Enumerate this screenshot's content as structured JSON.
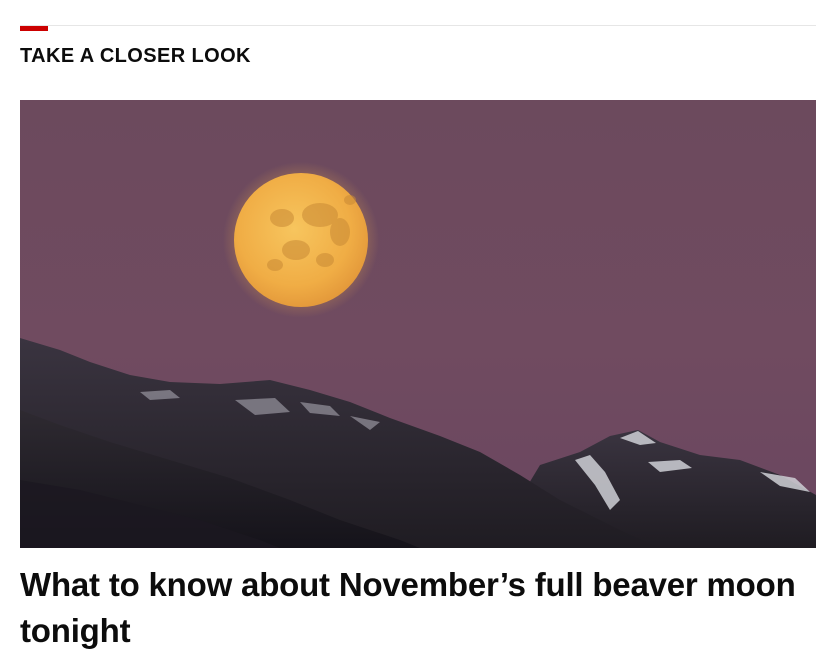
{
  "section": {
    "title": "TAKE A CLOSER LOOK",
    "accent_color": "#cc0000"
  },
  "card": {
    "image_subject": "full moon rising over dark mountains at dusk",
    "headline": "What to know about November’s full beaver moon tonight"
  },
  "colors": {
    "sky": "#6e4a5e",
    "moon": "#f2b24a",
    "mountains": "#25222a",
    "headline_text": "#0c0c0c"
  }
}
